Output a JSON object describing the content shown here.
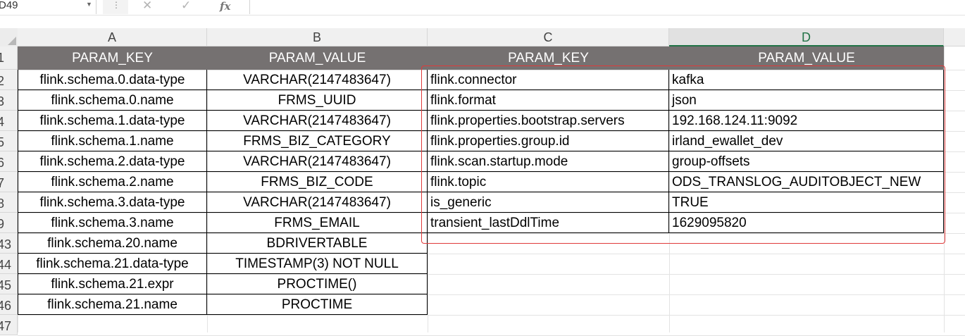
{
  "formula_bar": {
    "name_box": "D49",
    "name_box_icon": "chevron-down-icon",
    "separator_icon": "vertical-dots-icon",
    "cancel_icon": "close-icon",
    "enter_icon": "checkmark-icon",
    "function_label": "fx",
    "formula": ""
  },
  "sheet": {
    "columns": [
      "A",
      "B",
      "C",
      "D"
    ],
    "selected_column": "D",
    "row_headers": [
      "1",
      "2",
      "3",
      "4",
      "5",
      "6",
      "7",
      "8",
      "9",
      "43",
      "44",
      "45",
      "46",
      "47"
    ],
    "header_color": "#757171",
    "highlight_color": "#e03a3a",
    "table_left": {
      "headers": [
        "PARAM_KEY",
        "PARAM_VALUE"
      ],
      "rows": [
        [
          "flink.schema.0.data-type",
          "VARCHAR(2147483647)"
        ],
        [
          "flink.schema.0.name",
          "FRMS_UUID"
        ],
        [
          "flink.schema.1.data-type",
          "VARCHAR(2147483647)"
        ],
        [
          "flink.schema.1.name",
          "FRMS_BIZ_CATEGORY"
        ],
        [
          "flink.schema.2.data-type",
          "VARCHAR(2147483647)"
        ],
        [
          "flink.schema.2.name",
          "FRMS_BIZ_CODE"
        ],
        [
          "flink.schema.3.data-type",
          "VARCHAR(2147483647)"
        ],
        [
          "flink.schema.3.name",
          "FRMS_EMAIL"
        ],
        [
          "flink.schema.20.name",
          "BDRIVERTABLE"
        ],
        [
          "flink.schema.21.data-type",
          "TIMESTAMP(3) NOT NULL"
        ],
        [
          "flink.schema.21.expr",
          "PROCTIME()"
        ],
        [
          "flink.schema.21.name",
          "PROCTIME"
        ]
      ]
    },
    "table_right": {
      "headers": [
        "PARAM_KEY",
        "PARAM_VALUE"
      ],
      "rows": [
        [
          "flink.connector",
          "kafka"
        ],
        [
          "flink.format",
          "json"
        ],
        [
          "flink.properties.bootstrap.servers",
          "192.168.124.11:9092"
        ],
        [
          "flink.properties.group.id",
          "irland_ewallet_dev"
        ],
        [
          "flink.scan.startup.mode",
          "group-offsets"
        ],
        [
          "flink.topic",
          "ODS_TRANSLOG_AUDITOBJECT_NEW"
        ],
        [
          "is_generic",
          "TRUE"
        ],
        [
          "transient_lastDdlTime",
          "1629095820"
        ]
      ]
    }
  }
}
